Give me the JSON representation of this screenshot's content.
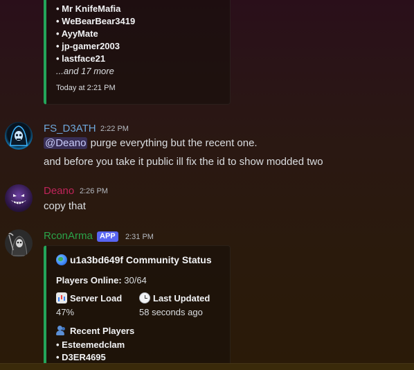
{
  "top_embed": {
    "players": [
      "Mr KnifeMafia",
      "WeBearBear3419",
      "AyyMate",
      "jp-gamer2003",
      "lastface21"
    ],
    "more": "...and 17 more",
    "footer": "Today at 2:21 PM"
  },
  "messages": [
    {
      "username": "FS_D3ATH",
      "timestamp": "2:22 PM",
      "mention": "@Deano",
      "line1_rest": " purge everything but the recent one.",
      "line2": "and before you take it public ill fix the id to show modded two"
    },
    {
      "username": "Deano",
      "timestamp": "2:26 PM",
      "line1": "copy that"
    },
    {
      "username": "RconArma",
      "badge": "APP",
      "timestamp": "2:31 PM"
    }
  ],
  "status_embed": {
    "title_icon": "globe-icon",
    "title": "u1a3bd649f Community Status",
    "players_online_label": "Players Online:",
    "players_online_value": "30/64",
    "server_load_icon": "bar-chart-icon",
    "server_load_label": "Server Load",
    "server_load_value": "47%",
    "last_updated_icon": "clock-icon",
    "last_updated_label": "Last Updated",
    "last_updated_value": "58 seconds ago",
    "recent_players_icon": "people-icon",
    "recent_players_label": "Recent Players",
    "recent_players": [
      "Esteemedclam",
      "D3ER4695"
    ]
  },
  "colors": {
    "fs_d3ath_name": "#6ea8dc",
    "deano_name": "#c0245a",
    "rconarma_name": "#2aa44a",
    "embed_accent": "#23a55a",
    "app_badge": "#5865f2"
  }
}
